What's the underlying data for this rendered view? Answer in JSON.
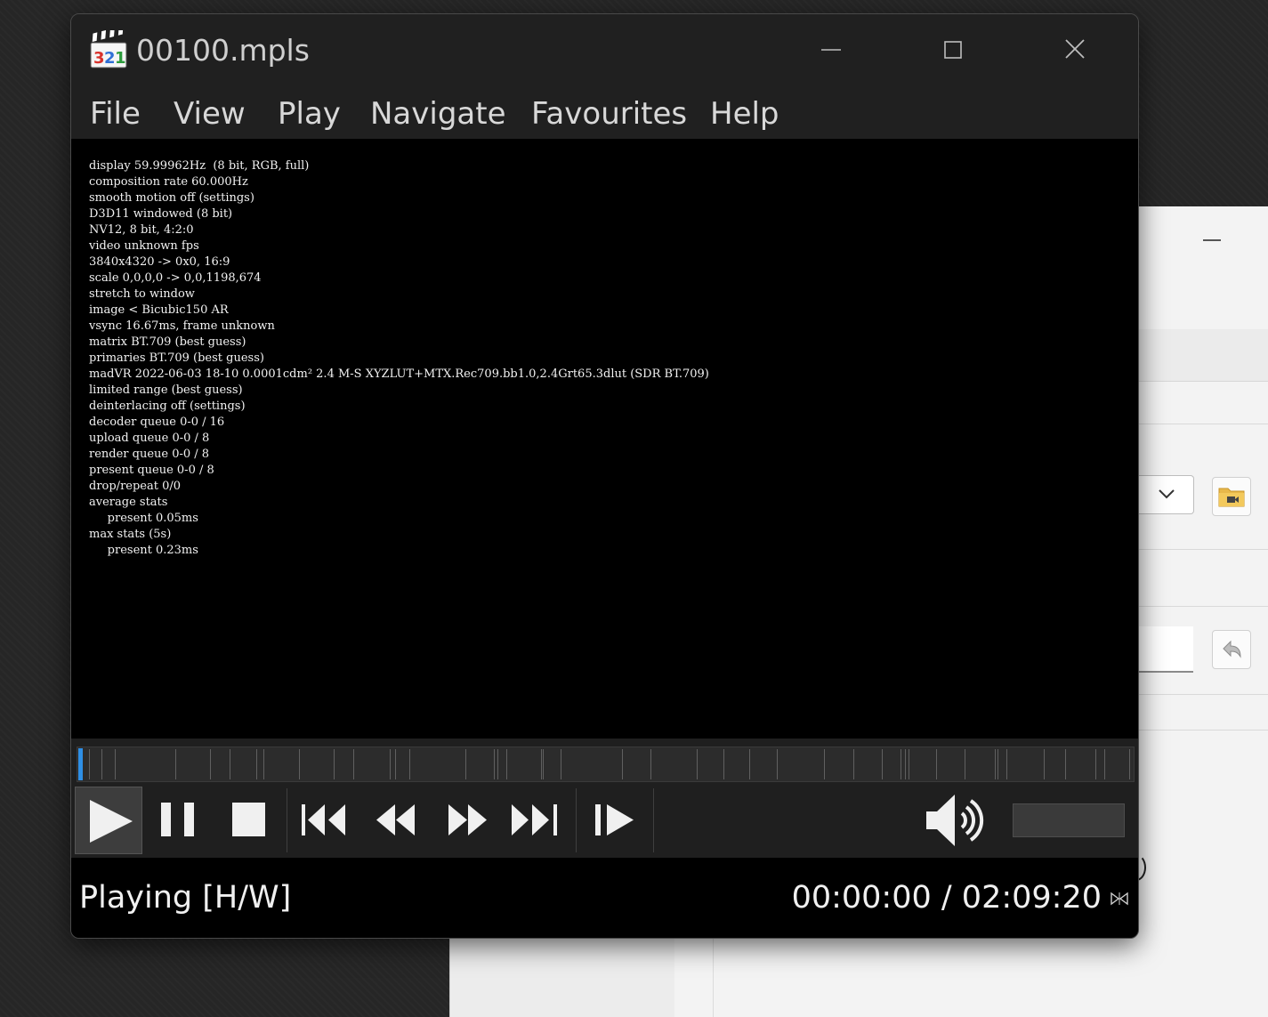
{
  "window": {
    "title": "00100.mpls"
  },
  "menu": {
    "items": [
      "File",
      "View",
      "Play",
      "Navigate",
      "Favourites",
      "Help"
    ]
  },
  "osd": {
    "lines": [
      "display 59.99962Hz  (8 bit, RGB, full)",
      "composition rate 60.000Hz",
      "smooth motion off (settings)",
      "D3D11 windowed (8 bit)",
      "NV12, 8 bit, 4:2:0",
      "video unknown fps",
      "3840x4320 -> 0x0, 16:9",
      "scale 0,0,0,0 -> 0,0,1198,674",
      "stretch to window",
      "image < Bicubic150 AR",
      "vsync 16.67ms, frame unknown",
      "matrix BT.709 (best guess)",
      "primaries BT.709 (best guess)",
      "madVR 2022-06-03 18-10 0.0001cdm² 2.4 M-S XYZLUT+MTX.Rec709.bb1.0,2.4Grt65.3dlut (SDR BT.709)",
      "limited range (best guess)",
      "deinterlacing off (settings)",
      "decoder queue 0-0 / 16",
      "upload queue 0-0 / 8",
      "render queue 0-0 / 8",
      "present queue 0-0 / 8",
      "drop/repeat 0/0",
      "average stats",
      "     present 0.05ms",
      "max stats (5s)",
      "     present 0.23ms"
    ]
  },
  "playback": {
    "progress": 0.0,
    "chapter_count": 42
  },
  "controls": {
    "icons": [
      "play-icon",
      "pause-icon",
      "stop-icon",
      "skip-previous-icon",
      "rewind-icon",
      "fast-forward-icon",
      "skip-next-icon",
      "frame-step-icon",
      "volume-icon"
    ]
  },
  "status": {
    "state": "Playing [H/W]",
    "time": "00:00:00 / 02:09:20"
  },
  "colors": {
    "accent": "#2e8fe6",
    "window_bg": "#202020",
    "video_bg": "#000000"
  }
}
